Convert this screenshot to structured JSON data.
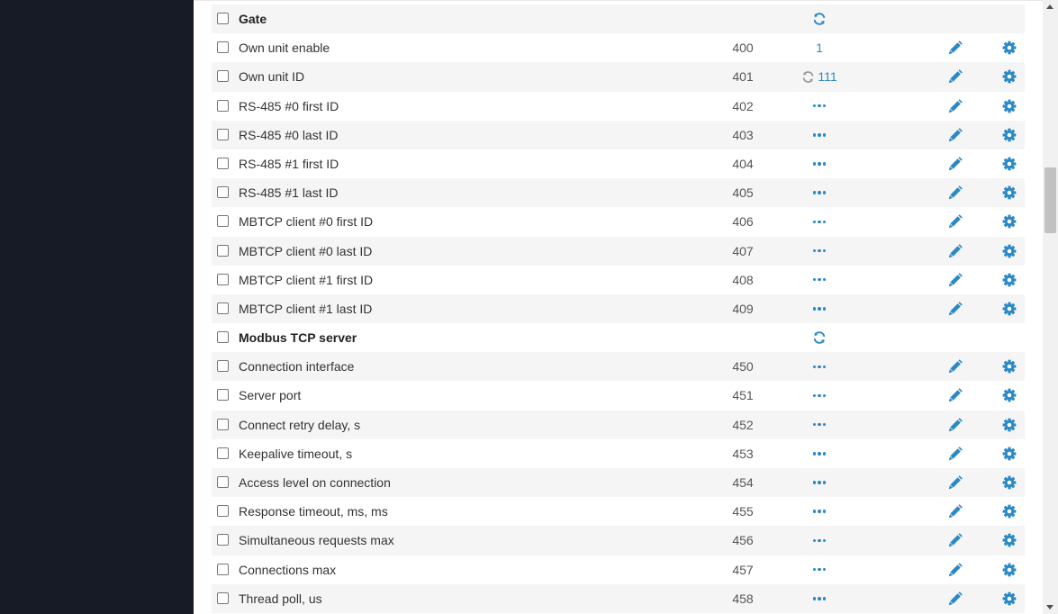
{
  "colors": {
    "sidebar": "#161b26",
    "accent": "#2a89c4",
    "stripe": "#f5f5f5"
  },
  "rows": [
    {
      "kind": "group",
      "name": "Gate",
      "value_type": "refresh"
    },
    {
      "kind": "item",
      "name": "Own unit enable",
      "register": "400",
      "value_type": "text",
      "value": "1"
    },
    {
      "kind": "item",
      "name": "Own unit ID",
      "register": "401",
      "value_type": "pending",
      "value": "111"
    },
    {
      "kind": "item",
      "name": "RS-485 #0 first ID",
      "register": "402",
      "value_type": "dots"
    },
    {
      "kind": "item",
      "name": "RS-485 #0 last ID",
      "register": "403",
      "value_type": "dots"
    },
    {
      "kind": "item",
      "name": "RS-485 #1 first ID",
      "register": "404",
      "value_type": "dots"
    },
    {
      "kind": "item",
      "name": "RS-485 #1 last ID",
      "register": "405",
      "value_type": "dots"
    },
    {
      "kind": "item",
      "name": "MBTCP client #0 first ID",
      "register": "406",
      "value_type": "dots"
    },
    {
      "kind": "item",
      "name": "MBTCP client #0 last ID",
      "register": "407",
      "value_type": "dots"
    },
    {
      "kind": "item",
      "name": "MBTCP client #1 first ID",
      "register": "408",
      "value_type": "dots"
    },
    {
      "kind": "item",
      "name": "MBTCP client #1 last ID",
      "register": "409",
      "value_type": "dots"
    },
    {
      "kind": "group",
      "name": "Modbus TCP server",
      "value_type": "refresh"
    },
    {
      "kind": "item",
      "name": "Connection interface",
      "register": "450",
      "value_type": "dots"
    },
    {
      "kind": "item",
      "name": "Server port",
      "register": "451",
      "value_type": "dots"
    },
    {
      "kind": "item",
      "name": "Connect retry delay, s",
      "register": "452",
      "value_type": "dots"
    },
    {
      "kind": "item",
      "name": "Keepalive timeout, s",
      "register": "453",
      "value_type": "dots"
    },
    {
      "kind": "item",
      "name": "Access level on connection",
      "register": "454",
      "value_type": "dots"
    },
    {
      "kind": "item",
      "name": "Response timeout, ms, ms",
      "register": "455",
      "value_type": "dots"
    },
    {
      "kind": "item",
      "name": "Simultaneous requests max",
      "register": "456",
      "value_type": "dots"
    },
    {
      "kind": "item",
      "name": "Connections max",
      "register": "457",
      "value_type": "dots"
    },
    {
      "kind": "item",
      "name": "Thread poll, us",
      "register": "458",
      "value_type": "dots"
    }
  ],
  "icons": {
    "refresh": "refresh-icon",
    "pending": "sync-pending-icon",
    "dots": "ellipsis-icon",
    "edit": "pencil-icon",
    "settings": "gear-icon"
  }
}
